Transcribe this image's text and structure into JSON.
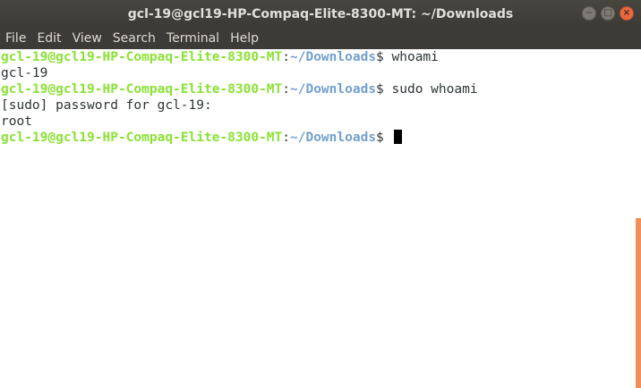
{
  "window": {
    "title": "gcl-19@gcl19-HP-Compaq-Elite-8300-MT: ~/Downloads",
    "controls": {
      "minimize": "−",
      "maximize": "□",
      "close": "×"
    }
  },
  "menu": [
    "File",
    "Edit",
    "View",
    "Search",
    "Terminal",
    "Help"
  ],
  "terminal": {
    "prompt_user": "gcl-19@gcl19-HP-Compaq-Elite-8300-MT",
    "prompt_sep": ":",
    "prompt_path": "~/Downloads",
    "prompt_end": "$ ",
    "lines": [
      {
        "type": "prompt",
        "command": "whoami"
      },
      {
        "type": "output",
        "text": "gcl-19"
      },
      {
        "type": "prompt",
        "command": "sudo whoami"
      },
      {
        "type": "output",
        "text": "[sudo] password for gcl-19:"
      },
      {
        "type": "output",
        "text": "root"
      },
      {
        "type": "prompt",
        "command": ""
      }
    ]
  },
  "colors": {
    "user": "#8ae234",
    "path": "#729fcf",
    "scroll_thumb": "#ef8f5a",
    "close_button": "#e9693f"
  }
}
